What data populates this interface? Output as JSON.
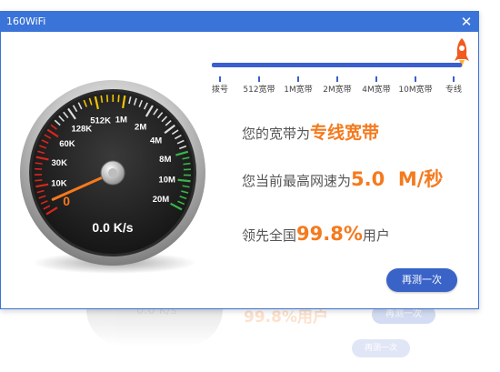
{
  "window": {
    "title": "160WiFi",
    "close_glyph": "✕"
  },
  "gauge": {
    "speed_text": "0.0 K/s",
    "needle_value": 0,
    "labels": [
      "0",
      "10K",
      "30K",
      "60K",
      "128K",
      "512K",
      "1M",
      "2M",
      "4M",
      "8M",
      "10M",
      "20M"
    ],
    "colors": {
      "red": "#d9261c",
      "yellow": "#f2c400",
      "green": "#39b54a",
      "needle": "#f57a1e"
    }
  },
  "bandwidth_scale": {
    "ticks": [
      "拨号",
      "512宽带",
      "1M宽带",
      "2M宽带",
      "4M宽带",
      "10M宽带",
      "专线"
    ],
    "current_index": 6
  },
  "results": {
    "bandwidth_prefix": "您的宽带为",
    "bandwidth_value": "专线宽带",
    "speed_prefix": "您当前最高网速为",
    "speed_value": "5.0  M/秒",
    "rank_prefix": "领先全国",
    "rank_value": "99.8%",
    "rank_suffix": "用户"
  },
  "retest_label": "再测一次",
  "reflection": {
    "text": "99.8%用户",
    "speed": "0.0 K/s",
    "button": "再测一次"
  },
  "colors": {
    "accent": "#3b74d8",
    "highlight": "#f57a1e",
    "button": "#3a63c8"
  }
}
